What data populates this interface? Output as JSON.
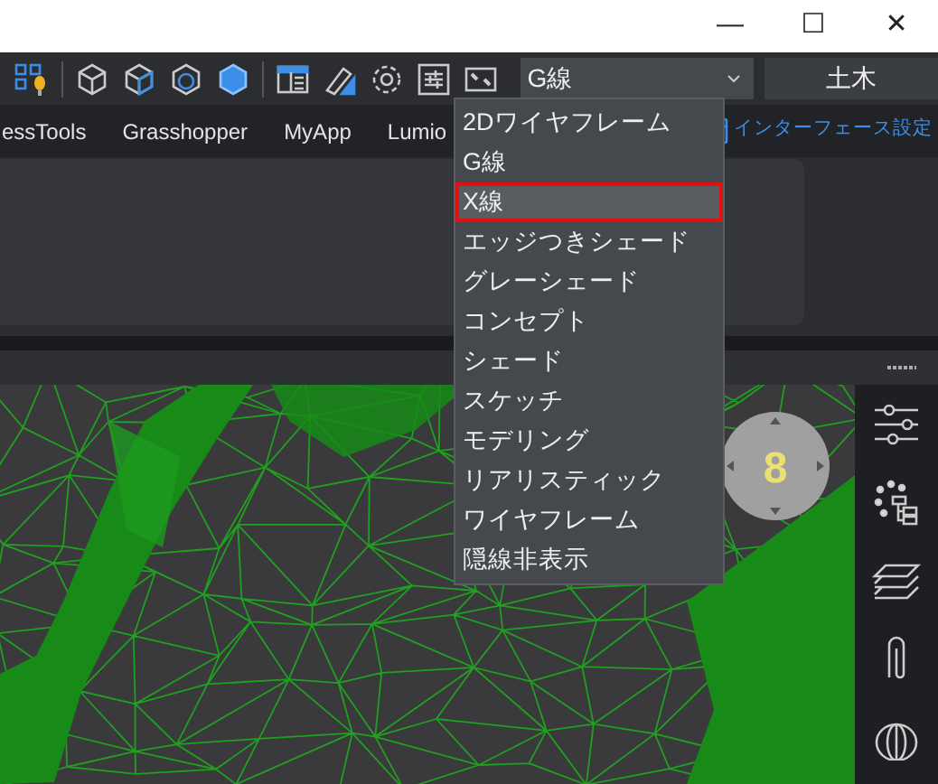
{
  "window": {
    "controls": [
      "—",
      "☐",
      "✕"
    ]
  },
  "toolbar": {
    "view_style": {
      "value": "G線",
      "expanded": true
    },
    "workspace": {
      "value": "土木"
    }
  },
  "ribbon_tabs": [
    {
      "label": "essTools"
    },
    {
      "label": "Grasshopper"
    },
    {
      "label": "MyApp"
    },
    {
      "label": "Lumio"
    }
  ],
  "interface_settings": {
    "label": "インターフェース設定"
  },
  "view_style_options": [
    {
      "label": "2Dワイヤフレーム",
      "highlighted": false
    },
    {
      "label": "G線",
      "highlighted": false
    },
    {
      "label": "X線",
      "highlighted": true
    },
    {
      "label": "エッジつきシェード",
      "highlighted": false
    },
    {
      "label": "グレーシェード",
      "highlighted": false
    },
    {
      "label": "コンセプト",
      "highlighted": false
    },
    {
      "label": "シェード",
      "highlighted": false
    },
    {
      "label": "スケッチ",
      "highlighted": false
    },
    {
      "label": "モデリング",
      "highlighted": false
    },
    {
      "label": "リアリスティック",
      "highlighted": false
    },
    {
      "label": "ワイヤフレーム",
      "highlighted": false
    },
    {
      "label": "隠線非表示",
      "highlighted": false
    }
  ],
  "viewport": {
    "nav_wheel_label": "8"
  }
}
